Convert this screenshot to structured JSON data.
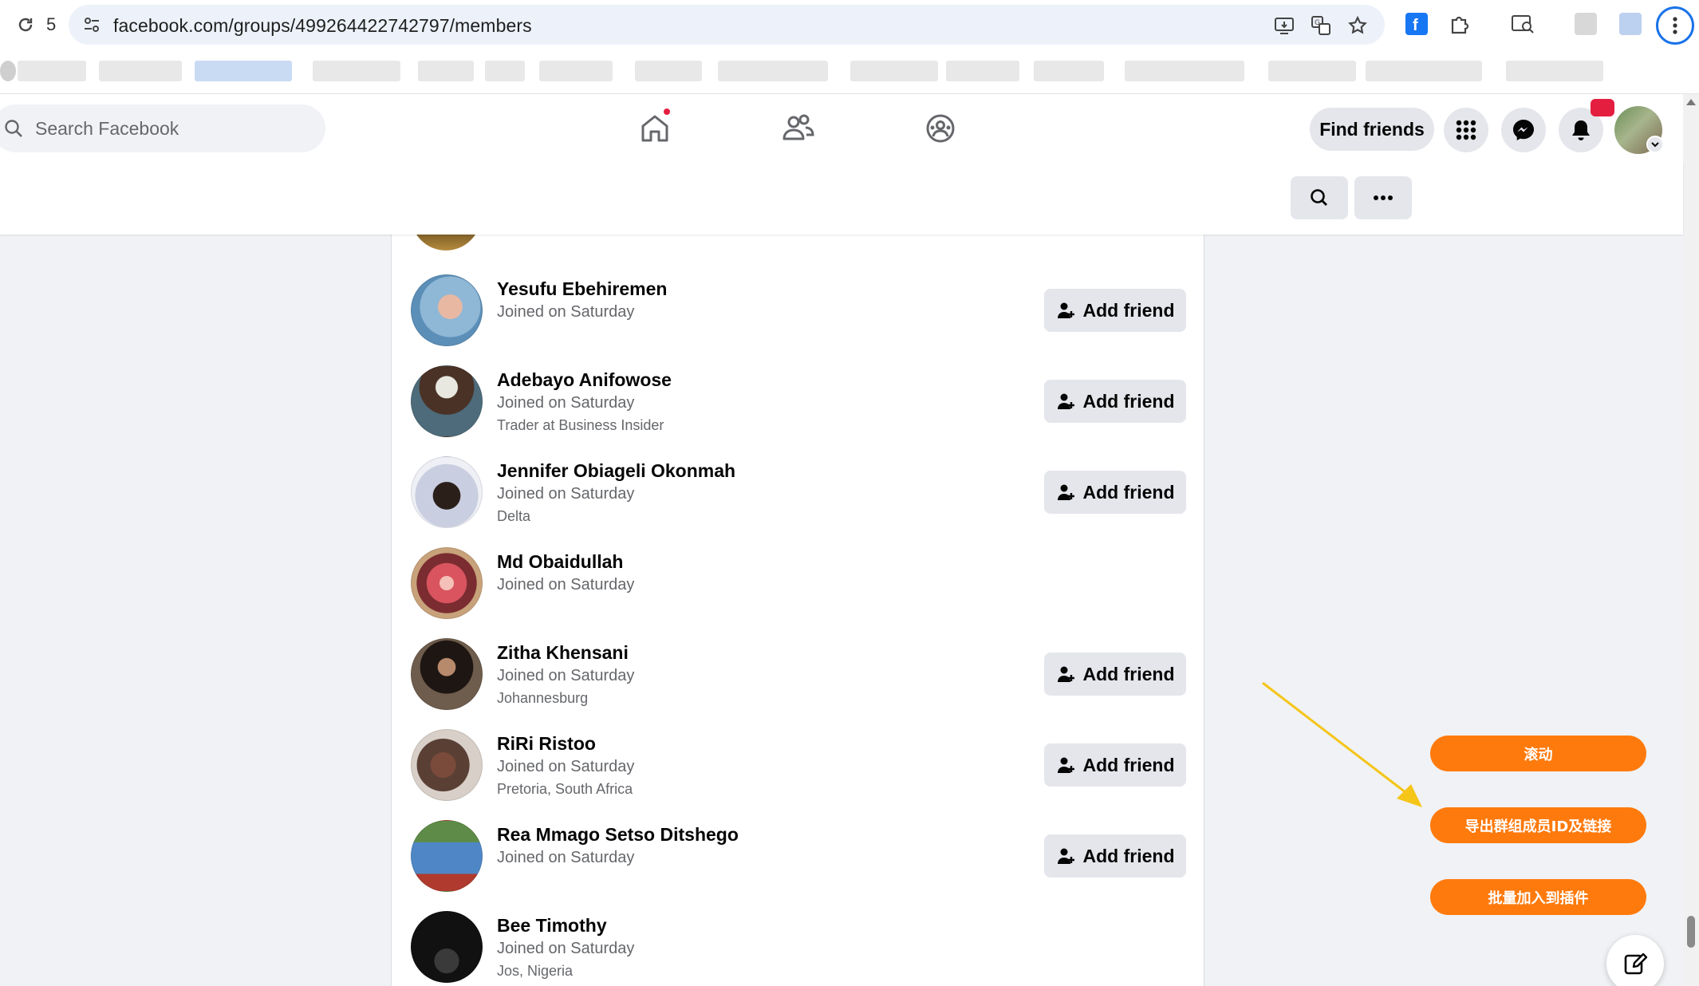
{
  "browser": {
    "tab_count": "5",
    "url": "facebook.com/groups/499264422742797/members",
    "icons": [
      "reload-icon",
      "site-info-icon",
      "install-app-icon",
      "translate-icon",
      "bookmark-star-icon",
      "facebook-extension-icon",
      "extensions-puzzle-icon",
      "reading-mode-icon",
      "browser-menu-icon"
    ]
  },
  "header": {
    "search_placeholder": "Search Facebook",
    "find_friends_label": "Find friends",
    "nav_icons": [
      "home-icon",
      "friends-icon",
      "groups-icon"
    ],
    "action_icons": [
      "menu-grid-icon",
      "messenger-icon",
      "notifications-bell-icon"
    ]
  },
  "subheader": {
    "icons": [
      "search-icon",
      "more-options-icon"
    ]
  },
  "members": [
    {
      "name": "Yesufu Ebehiremen",
      "joined": "Joined on Saturday",
      "extra": "",
      "add_friend": "Add friend",
      "avatar_color": "#8fb7d6"
    },
    {
      "name": "Adebayo Anifowose",
      "joined": "Joined on Saturday",
      "extra": "Trader at Business Insider",
      "add_friend": "Add friend",
      "avatar_color": "#4d6b7a"
    },
    {
      "name": "Jennifer Obiageli Okonmah",
      "joined": "Joined on Saturday",
      "extra": "Delta",
      "add_friend": "Add friend",
      "avatar_color": "#c9cfe0"
    },
    {
      "name": "Md Obaidullah",
      "joined": "Joined on Saturday",
      "extra": "",
      "add_friend": "",
      "avatar_color": "#d9545f"
    },
    {
      "name": "Zitha Khensani",
      "joined": "Joined on Saturday",
      "extra": "Johannesburg",
      "add_friend": "Add friend",
      "avatar_color": "#6e5c4c"
    },
    {
      "name": "RiRi Ristoo",
      "joined": "Joined on Saturday",
      "extra": "Pretoria, South Africa",
      "add_friend": "Add friend",
      "avatar_color": "#5a3f35"
    },
    {
      "name": "Rea Mmago Setso Ditshego",
      "joined": "Joined on Saturday",
      "extra": "",
      "add_friend": "Add friend",
      "avatar_color": "#4f86c6"
    },
    {
      "name": "Bee Timothy",
      "joined": "Joined on Saturday",
      "extra": "Jos, Nigeria",
      "add_friend": "",
      "avatar_color": "#111111"
    }
  ],
  "plugin": {
    "scroll_label": "滚动",
    "export_label": "导出群组成员ID及链接",
    "batch_label": "批量加入到插件"
  },
  "colors": {
    "plugin_orange": "#ff7a0c",
    "annotation_arrow": "#f5c518",
    "notification_red": "#e41e3f"
  },
  "compose_icon": "compose-edit-icon"
}
